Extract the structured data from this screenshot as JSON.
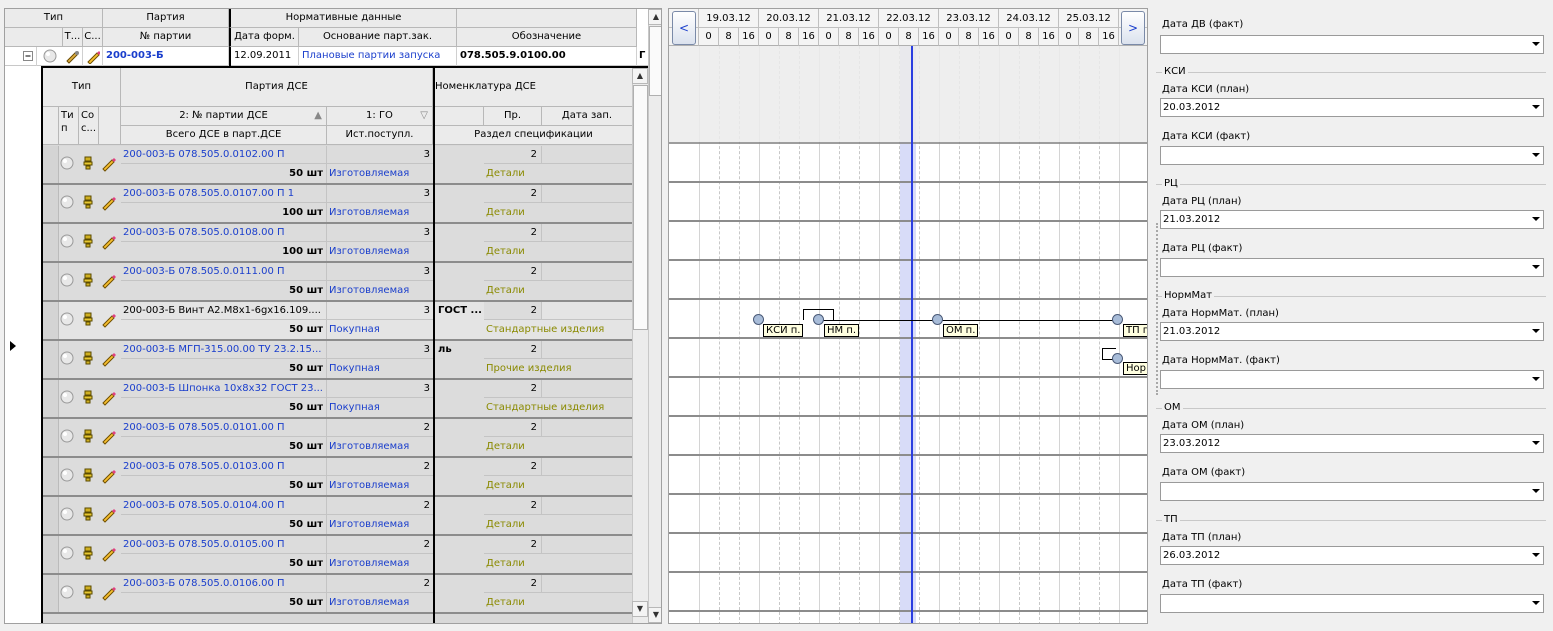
{
  "left_grid": {
    "header_top": {
      "type": "Тип",
      "party": "Партия",
      "normative": "Нормативные данные"
    },
    "header_sub": {
      "t": "Т...",
      "c": "С...",
      "party_no": "№ партии",
      "date_form": "Дата форм.",
      "basis": "Основание парт.зак.",
      "designation": "Обозначение"
    },
    "outer_row": {
      "party_no": "200-003-Б",
      "date": "12.09.2011",
      "basis": "Плановые партии запуска",
      "designation": "078.505.9.0100.00",
      "trailing": "Г"
    },
    "inner_header": {
      "type": "Тип",
      "party_dse": "Партия ДСЕ",
      "nomenclature": "Номенклатура ДСЕ",
      "ti": "Ти п",
      "co": "Со с...",
      "sort1": "2: № партии ДСЕ",
      "sort2": "1: ГО",
      "pr": "Пр.",
      "date_zap": "Дата зап.",
      "total": "Всего ДСЕ в парт.ДСЕ",
      "source": "Ист.поступл.",
      "section": "Раздел спецификации"
    },
    "rows": [
      {
        "name": "200-003-Б 078.505.0.0102.00 П",
        "go": "3",
        "pr": "2",
        "qty": "50 шт",
        "source": "Изготовляемая",
        "section": "Детали",
        "nom": "",
        "blue": true,
        "current": false
      },
      {
        "name": "200-003-Б 078.505.0.0107.00 П 1",
        "go": "3",
        "pr": "2",
        "qty": "100 шт",
        "source": "Изготовляемая",
        "section": "Детали",
        "nom": "",
        "blue": true,
        "current": false
      },
      {
        "name": "200-003-Б 078.505.0.0108.00 П",
        "go": "3",
        "pr": "2",
        "qty": "100 шт",
        "source": "Изготовляемая",
        "section": "Детали",
        "nom": "",
        "blue": true,
        "current": false
      },
      {
        "name": "200-003-Б 078.505.0.0111.00 П",
        "go": "3",
        "pr": "2",
        "qty": "50 шт",
        "source": "Изготовляемая",
        "section": "Детали",
        "nom": "",
        "blue": true,
        "current": false
      },
      {
        "name": "200-003-Б Винт A2.M8x1-6gx16.109....",
        "go": "3",
        "pr": "2",
        "qty": "50 шт",
        "source": "Покупная",
        "section": "Стандартные изделия",
        "nom": "ГОСТ ...",
        "blue": false,
        "current": true
      },
      {
        "name": "200-003-Б МГП-315.00.00 ТУ 23.2.15...",
        "go": "3",
        "pr": "2",
        "qty": "50 шт",
        "source": "Покупная",
        "section": "Прочие изделия",
        "nom": "ль",
        "blue": true,
        "current": false
      },
      {
        "name": "200-003-Б Шпонка 10x8x32 ГОСТ 23...",
        "go": "3",
        "pr": "2",
        "qty": "50 шт",
        "source": "Покупная",
        "section": "Стандартные изделия",
        "nom": "",
        "blue": true,
        "current": false
      },
      {
        "name": "200-003-Б 078.505.0.0101.00 П",
        "go": "2",
        "pr": "2",
        "qty": "50 шт",
        "source": "Изготовляемая",
        "section": "Детали",
        "nom": "",
        "blue": true,
        "current": false
      },
      {
        "name": "200-003-Б 078.505.0.0103.00 П",
        "go": "2",
        "pr": "2",
        "qty": "50 шт",
        "source": "Изготовляемая",
        "section": "Детали",
        "nom": "",
        "blue": true,
        "current": false
      },
      {
        "name": "200-003-Б 078.505.0.0104.00 П",
        "go": "2",
        "pr": "2",
        "qty": "50 шт",
        "source": "Изготовляемая",
        "section": "Детали",
        "nom": "",
        "blue": true,
        "current": false
      },
      {
        "name": "200-003-Б 078.505.0.0105.00 П",
        "go": "2",
        "pr": "2",
        "qty": "50 шт",
        "source": "Изготовляемая",
        "section": "Детали",
        "nom": "",
        "blue": true,
        "current": false
      },
      {
        "name": "200-003-Б 078.505.0.0106.00 П",
        "go": "2",
        "pr": "2",
        "qty": "50 шт",
        "source": "Изготовляемая",
        "section": "Детали",
        "nom": "",
        "blue": true,
        "current": false
      }
    ]
  },
  "gantt": {
    "prev": "<",
    "next": ">",
    "days": [
      "19.03.12",
      "20.03.12",
      "21.03.12",
      "22.03.12",
      "23.03.12",
      "24.03.12",
      "25.03.12"
    ],
    "hours": [
      "0",
      "8",
      "16"
    ],
    "milestones": [
      "КСИ п.",
      "НМ п.",
      "ОМ п.",
      "ТП п",
      "Нор"
    ]
  },
  "right_panel": {
    "dv_fact_label": "Дата ДВ (факт)",
    "groups": [
      {
        "title": "КСИ",
        "plan_label": "Дата КСИ (план)",
        "plan_value": "20.03.2012",
        "fact_label": "Дата КСИ (факт)",
        "fact_value": ""
      },
      {
        "title": "РЦ",
        "plan_label": "Дата РЦ (план)",
        "plan_value": "21.03.2012",
        "fact_label": "Дата РЦ (факт)",
        "fact_value": ""
      },
      {
        "title": "НормМат",
        "plan_label": "Дата НормМат. (план)",
        "plan_value": "21.03.2012",
        "fact_label": "Дата НормМат. (факт)",
        "fact_value": ""
      },
      {
        "title": "ОМ",
        "plan_label": "Дата ОМ (план)",
        "plan_value": "23.03.2012",
        "fact_label": "Дата ОМ (факт)",
        "fact_value": ""
      },
      {
        "title": "ТП",
        "plan_label": "Дата ТП (план)",
        "plan_value": "26.03.2012",
        "fact_label": "Дата ТП (факт)",
        "fact_value": ""
      }
    ]
  },
  "colors": {
    "link_blue": "#1a3ecc",
    "olive": "#8a8a00",
    "today_line": "#2a3ee0",
    "today_band": "#d8dcf8"
  }
}
